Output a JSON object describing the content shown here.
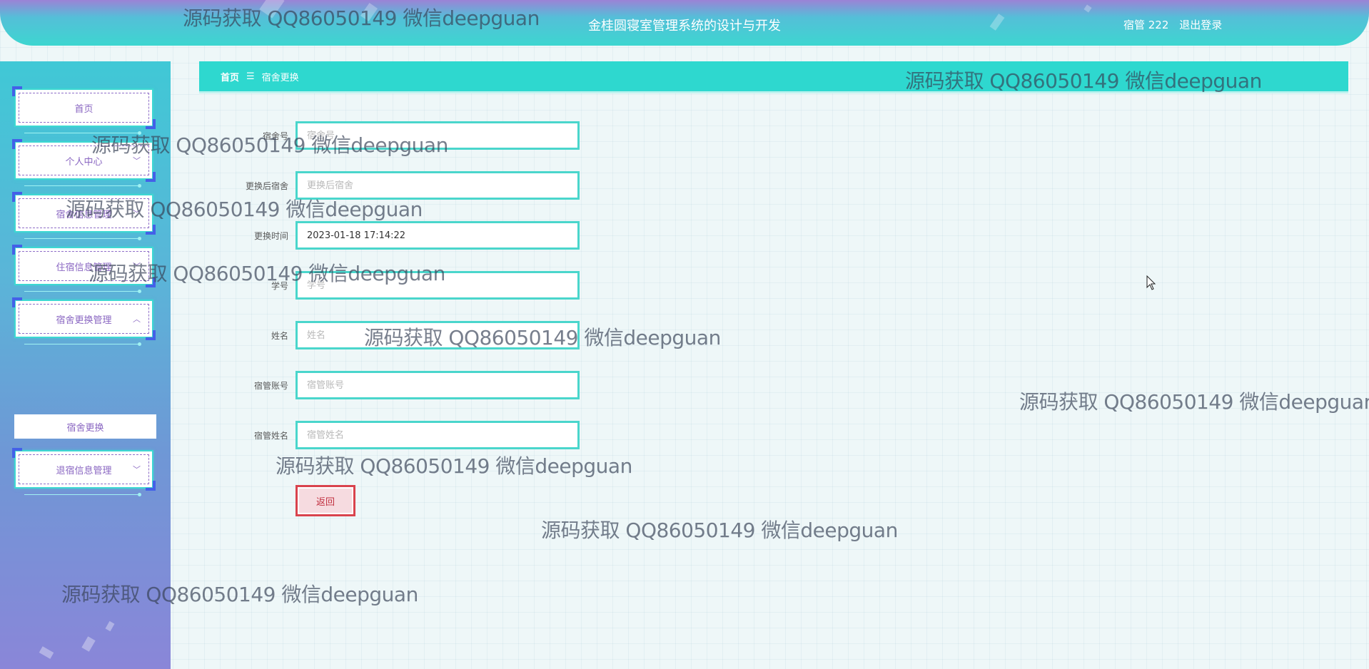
{
  "header": {
    "title": "金桂圆寝室管理系统的设计与开发",
    "user_label": "宿管 222",
    "logout_label": "退出登录"
  },
  "sidebar": {
    "items": [
      {
        "label": "首页",
        "chevron": ""
      },
      {
        "label": "个人中心",
        "chevron": "﹀"
      },
      {
        "label": "宿舍信息管理",
        "chevron": "﹀"
      },
      {
        "label": "住宿信息管理",
        "chevron": "﹀"
      },
      {
        "label": "宿舍更换管理",
        "chevron": "︿"
      },
      {
        "label": "退宿信息管理",
        "chevron": "﹀"
      }
    ],
    "active_sub_item": "宿舍更换"
  },
  "breadcrumb": {
    "home": "首页",
    "separator": "☰",
    "current": "宿舍更换"
  },
  "form": {
    "fields": [
      {
        "label": "宿舍号",
        "value": "",
        "placeholder": "宿舍号"
      },
      {
        "label": "更换后宿舍",
        "value": "",
        "placeholder": "更换后宿舍"
      },
      {
        "label": "更换时间",
        "value": "2023-01-18 17:14:22",
        "placeholder": ""
      },
      {
        "label": "学号",
        "value": "",
        "placeholder": "学号"
      },
      {
        "label": "姓名",
        "value": "",
        "placeholder": "姓名"
      },
      {
        "label": "宿管账号",
        "value": "",
        "placeholder": "宿管账号"
      },
      {
        "label": "宿管姓名",
        "value": "",
        "placeholder": "宿管姓名"
      }
    ],
    "back_label": "返回"
  },
  "watermark": {
    "text": "源码获取 QQ86050149 微信deepguan"
  },
  "colors": {
    "accent": "#2ed8cf",
    "menu_text": "#8a67c2",
    "input_border": "#4ad6cc",
    "back_border": "#d9434d"
  }
}
